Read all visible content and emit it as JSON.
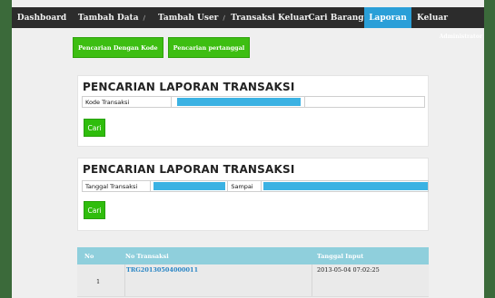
{
  "nav": {
    "items": [
      {
        "label": "Dashboard",
        "caret": ""
      },
      {
        "label": "Tambah Data",
        "caret": "∕"
      },
      {
        "label": "Tambah User",
        "caret": "∕"
      },
      {
        "label": "Transaksi Keluar",
        "caret": ""
      },
      {
        "label": "Cari Barang",
        "caret": ""
      },
      {
        "label": "Laporan",
        "caret": ""
      },
      {
        "label": "Keluar",
        "caret": ""
      }
    ],
    "active": "Laporan",
    "user": "Administrator"
  },
  "tabs": {
    "by_code": "Pencarian Dengan Kode",
    "by_date": "Pencarian pertanggal"
  },
  "search_code": {
    "title": "PENCARIAN LAPORAN TRANSAKSI",
    "label": "Kode Transaksi",
    "button": "Cari"
  },
  "search_date": {
    "title": "PENCARIAN LAPORAN TRANSAKSI",
    "label": "Tanggal Transaksi",
    "to_label": "Sampai",
    "button": "Cari"
  },
  "table": {
    "headers": {
      "no": "No",
      "trans": "No Transaksi",
      "date": "Tanggal Input"
    },
    "rows": [
      {
        "no": "1",
        "trans": "TRG20130504000011",
        "date": "2013-05-04 07:02:25"
      }
    ]
  },
  "colors": {
    "active_nav": "#2a9fd8",
    "green_button": "#3dbe12",
    "input_blue": "#3bb2e3",
    "table_header": "#8fcfdc"
  }
}
